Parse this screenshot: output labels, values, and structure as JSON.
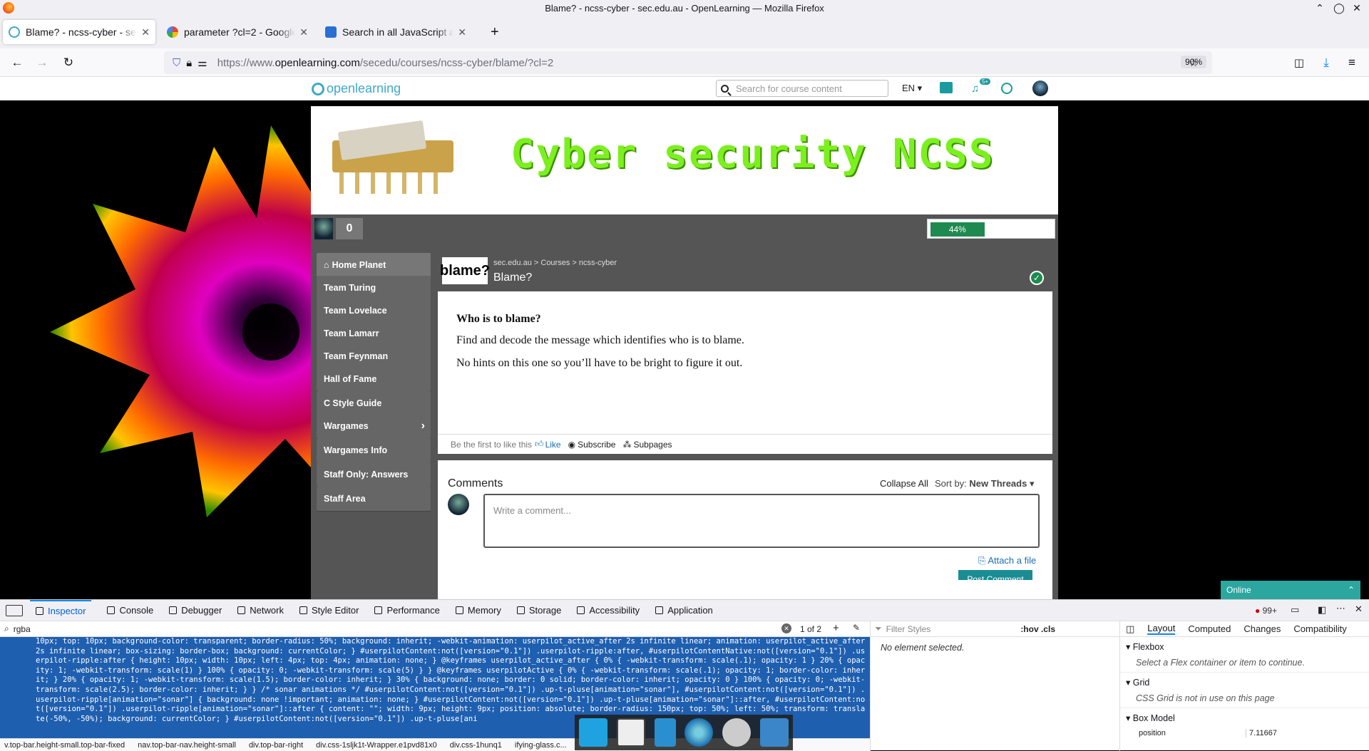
{
  "window": {
    "title": "Blame? - ncss-cyber - sec.edu.au - OpenLearning — Mozilla Firefox"
  },
  "tabs": [
    {
      "label": "Blame? - ncss-cyber - sec.e",
      "active": true
    },
    {
      "label": "parameter ?cl=2 - Google",
      "active": false
    },
    {
      "label": "Search in all JavaScript a",
      "active": false
    }
  ],
  "address": {
    "prefix": "https://www.",
    "host": "openlearning.com",
    "path": "/secedu/courses/ncss-cyber/blame/?cl=2",
    "zoom": "90%"
  },
  "site": {
    "logo": "openlearning",
    "search_placeholder": "Search for course content",
    "language": "EN",
    "notif_badge": "5+"
  },
  "banner": {
    "title": "Cyber security NCSS"
  },
  "user": {
    "score": "0",
    "progress_label": "44%",
    "progress": 0.44
  },
  "sidebar": {
    "items": [
      "Home Planet",
      "Team Turing",
      "Team Lovelace",
      "Team Lamarr",
      "Team Feynman",
      "Hall of Fame",
      "C Style Guide",
      "Wargames",
      "Wargames Info",
      "Staff Only: Answers",
      "Staff Area"
    ]
  },
  "page": {
    "thumb": "blame?",
    "breadcrumb": [
      "sec.edu.au",
      "Courses",
      "ncss-cyber"
    ],
    "title": "Blame?",
    "heading": "Who is to blame?",
    "p1": "Find and decode the message which identifies who is to blame.",
    "p2": "No hints on this one so you’ll have to be bright to figure it out."
  },
  "likebar": {
    "text": "Be the first to like this",
    "like": "Like",
    "subscribe": "Subscribe",
    "subpages": "Subpages"
  },
  "comments": {
    "title": "Comments",
    "collapse": "Collapse All",
    "sort_label": "Sort by:",
    "sort_value": "New Threads",
    "placeholder": "Write a comment...",
    "attach": "Attach a file",
    "post": "Post Comment"
  },
  "online": "Online",
  "devtools": {
    "tabs": [
      "Inspector",
      "Console",
      "Debugger",
      "Network",
      "Style Editor",
      "Performance",
      "Memory",
      "Storage",
      "Accessibility",
      "Application"
    ],
    "errors": "99+",
    "search_value": "rgba",
    "match_count": "1 of 2",
    "filter_placeholder": "Filter Styles",
    "pseudo": ":hov .cls",
    "no_element": "No element selected.",
    "layout_tabs": [
      "Layout",
      "Computed",
      "Changes",
      "Compatibility"
    ],
    "flexbox": "Flexbox",
    "flexbox_note": "Select a Flex container or item to continue.",
    "grid": "Grid",
    "grid_note": "CSS Grid is not in use on this page",
    "boxmodel": "Box Model",
    "position_label": "position",
    "position_value": "7.11667",
    "code": "10px; top: 10px; background-color: transparent; border-radius: 50%; background: inherit; -webkit-animation: userpilot_active_after 2s infinite linear; animation: userpilot_active_after 2s infinite linear; box-sizing: border-box; background: currentColor; } #userpilotContent:not([version=\"0.1\"]) .userpilot-ripple:after, #userpilotContentNative:not([version=\"0.1\"]) .userpilot-ripple:after { height: 10px; width: 10px; left: 4px; top: 4px; animation: none; } @keyframes userpilot_active_after { 0% { -webkit-transform: scale(.1); opacity: 1 } 20% { opacity: 1; -webkit-transform: scale(1) } 100% { opacity: 0; -webkit-transform: scale(5) } } @keyframes userpilotActive { 0% { -webkit-transform: scale(.1); opacity: 1; border-color: inherit; } 20% { opacity: 1; -webkit-transform: scale(1.5); border-color: inherit; } 30% { background: none; border: 0 solid; border-color: inherit; opacity: 0 } 100% { opacity: 0; -webkit-transform: scale(2.5); border-color: inherit; } } /* sonar animations */ #userpilotContent:not([version=\"0.1\"]) .up-t-pluse[animation=\"sonar\"], #userpilotContent:not([version=\"0.1\"]) .userpilot-ripple[animation=\"sonar\"] { background: none !important; animation: none; } #userpilotContent:not([version=\"0.1\"]) .up-t-pluse[animation=\"sonar\"]::after, #userpilotContent:not([version=\"0.1\"]) .userpilot-ripple[animation=\"sonar\"]::after { content: \"\"; width: 9px; height: 9px; position: absolute; border-radius: 150px; top: 50%; left: 50%; transform: translate(-50%, -50%); background: currentColor; } #userpilotContent:not([version=\"0.1\"]) .up-t-pluse[ani",
    "crumbs": [
      "v.top-bar.height-small.top-bar-fixed",
      "nav.top-bar-nav.height-small",
      "div.top-bar-right",
      "div.css-1sljk1t-Wrapper.e1pvd81x0",
      "div.css-1hunq1",
      "ifying-glass.c..."
    ]
  },
  "colors": {
    "accent": "#1e8a4f",
    "brand": "#3fa9c9",
    "banner_text": "#7cf01e",
    "online": "#2ba7a0",
    "selection": "#1f5fb0"
  }
}
